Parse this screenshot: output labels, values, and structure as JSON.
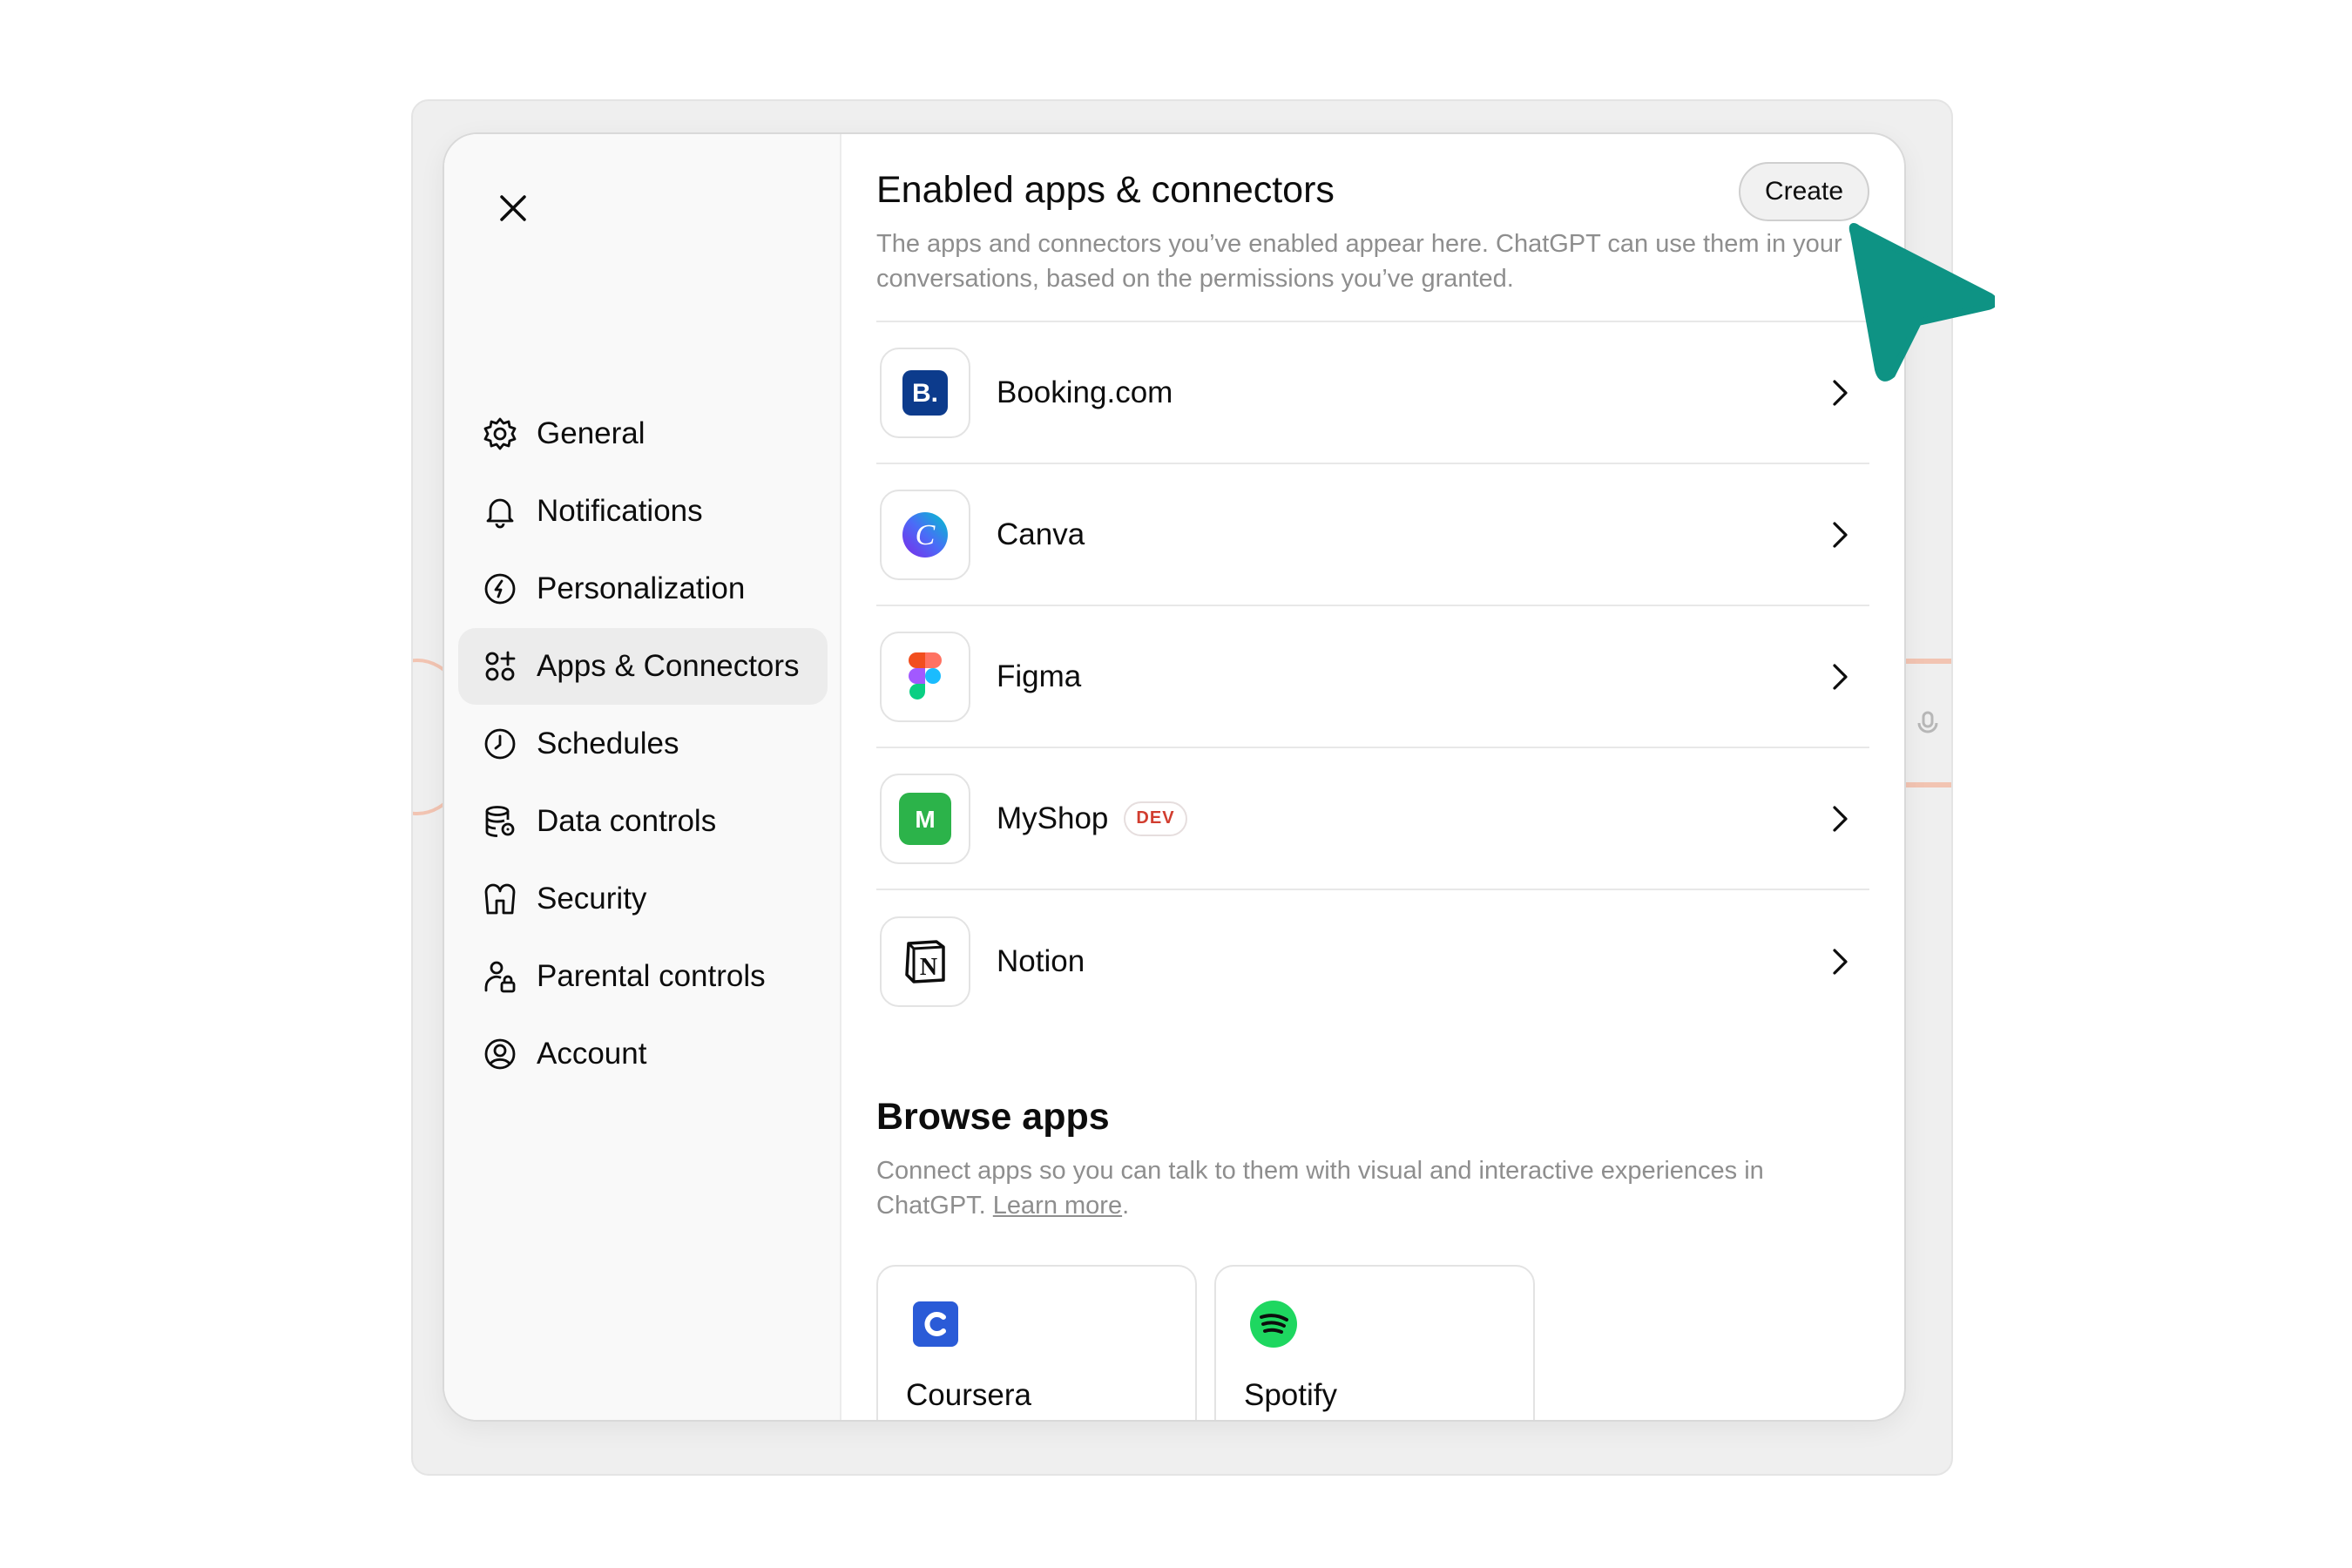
{
  "sidebar": {
    "close_label": "Close",
    "items": [
      {
        "label": "General",
        "icon": "gear-icon"
      },
      {
        "label": "Notifications",
        "icon": "bell-icon"
      },
      {
        "label": "Personalization",
        "icon": "personalization-icon"
      },
      {
        "label": "Apps & Connectors",
        "icon": "apps-icon",
        "active": true
      },
      {
        "label": "Schedules",
        "icon": "clock-icon"
      },
      {
        "label": "Data controls",
        "icon": "database-gear-icon"
      },
      {
        "label": "Security",
        "icon": "shield-icon"
      },
      {
        "label": "Parental controls",
        "icon": "person-lock-icon"
      },
      {
        "label": "Account",
        "icon": "user-circle-icon"
      }
    ]
  },
  "enabled": {
    "title": "Enabled apps & connectors",
    "create_label": "Create",
    "description": "The apps and connectors you’ve enabled appear here. ChatGPT can use them in your conversations, based on the permissions you’ve granted.",
    "apps": [
      {
        "name": "Booking.com",
        "icon": "booking-icon"
      },
      {
        "name": "Canva",
        "icon": "canva-icon"
      },
      {
        "name": "Figma",
        "icon": "figma-icon"
      },
      {
        "name": "MyShop",
        "icon": "myshop-icon",
        "badge": "DEV"
      },
      {
        "name": "Notion",
        "icon": "notion-icon"
      }
    ]
  },
  "browse": {
    "title": "Browse apps",
    "description": "Connect apps so you can talk to them with visual and interactive experiences in ChatGPT.",
    "learn_more": "Learn more",
    "period": ".",
    "apps": [
      {
        "name": "Coursera",
        "icon": "coursera-icon"
      },
      {
        "name": "Spotify",
        "icon": "spotify-icon"
      }
    ]
  },
  "colors": {
    "cursor": "#0e9384",
    "booking": "#0c3b8c",
    "myshop": "#2cb34a",
    "coursera": "#2a5bd7",
    "spotify": "#1ed760",
    "dev_badge": "#d13d2f"
  }
}
